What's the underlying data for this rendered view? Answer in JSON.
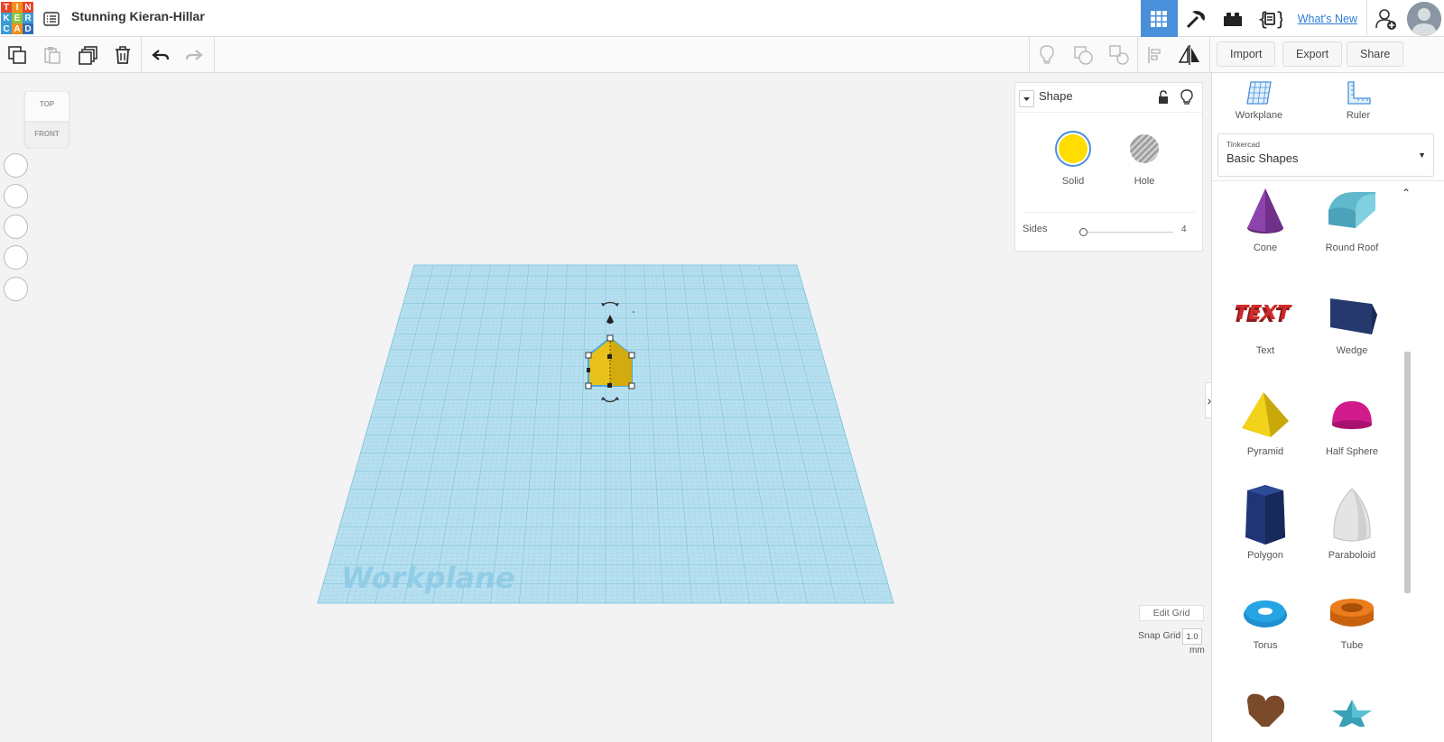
{
  "app": {
    "logo_letters": [
      "T",
      "I",
      "N",
      "K",
      "E",
      "R",
      "C",
      "A",
      "D"
    ],
    "logo_colors": [
      "#e8462a",
      "#f38f1c",
      "#e8462a",
      "#3a9bd5",
      "#8bc43f",
      "#3a9bd5",
      "#3a9bd5",
      "#f38f1c",
      "#2f6cb3"
    ],
    "design_title": "Stunning Kieran-Hillar",
    "whats_new": "What's New"
  },
  "header_icons": [
    "design-list-icon",
    "3d-view-grid-icon",
    "pickaxe-icon",
    "bricks-icon",
    "codeblocks-icon",
    "add-user-icon",
    "avatar"
  ],
  "toolbar": {
    "import_label": "Import",
    "export_label": "Export",
    "share_label": "Share",
    "tools": [
      "copy-icon",
      "paste-icon",
      "duplicate-icon",
      "delete-icon",
      "undo-icon",
      "redo-icon",
      "show-all-icon",
      "group-icon",
      "ungroup-icon",
      "align-icon",
      "mirror-icon"
    ]
  },
  "view_cube": {
    "top": "TOP",
    "front": "FRONT"
  },
  "shape_panel": {
    "title": "Shape",
    "solid_label": "Solid",
    "hole_label": "Hole",
    "sides_label": "Sides",
    "sides_value": "4",
    "solid_color": "#ffdd00"
  },
  "workplane": {
    "label": "Workplane",
    "color": "#a7d6ea"
  },
  "grid": {
    "edit_grid_label": "Edit Grid",
    "snap_grid_label": "Snap Grid",
    "snap_value": "1.0",
    "snap_unit": "mm"
  },
  "sidebar": {
    "workplane_label": "Workplane",
    "ruler_label": "Ruler",
    "library_category": "Tinkercad",
    "library_name": "Basic Shapes",
    "shapes": [
      {
        "label": "Cone"
      },
      {
        "label": "Round Roof"
      },
      {
        "label": "Text"
      },
      {
        "label": "Wedge"
      },
      {
        "label": "Pyramid"
      },
      {
        "label": "Half Sphere"
      },
      {
        "label": "Polygon"
      },
      {
        "label": "Paraboloid"
      },
      {
        "label": "Torus"
      },
      {
        "label": "Tube"
      }
    ]
  }
}
